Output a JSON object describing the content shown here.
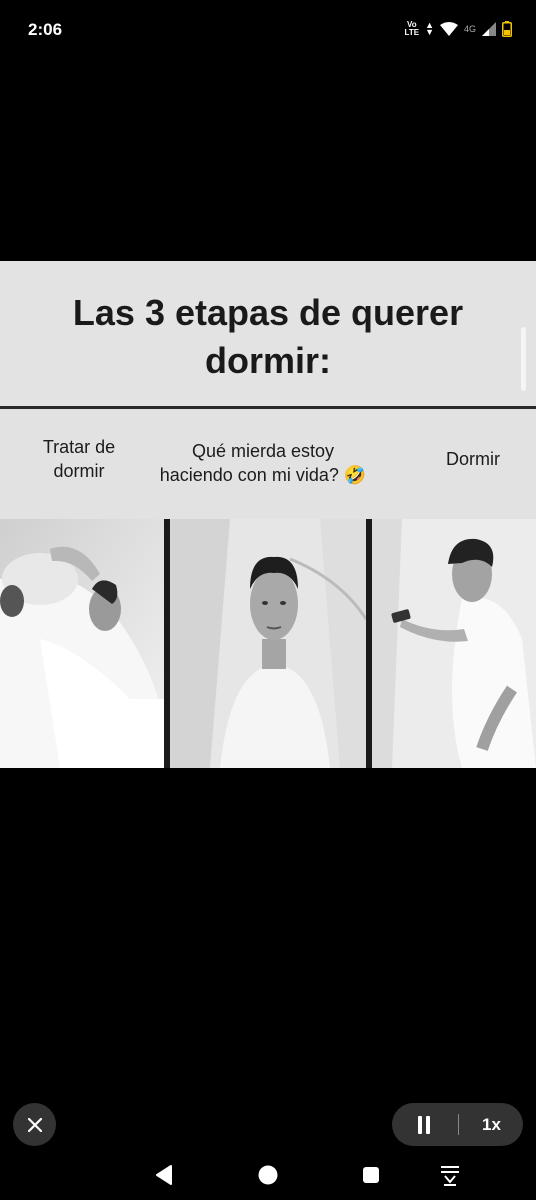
{
  "status_bar": {
    "time": "2:06",
    "volte_line1": "Vo",
    "volte_line2": "LTE",
    "network": "4G",
    "icons": [
      "volte-icon",
      "data-arrows-icon",
      "wifi-icon",
      "signal-icon",
      "battery-icon"
    ]
  },
  "meme": {
    "title": "Las 3 etapas de querer dormir:",
    "captions": [
      {
        "line1": "Tratar de",
        "line2": "dormir"
      },
      {
        "line1": "Qué mierda estoy",
        "line2": "haciendo con mi vida? 🤣"
      },
      {
        "line1": "Dormir"
      }
    ]
  },
  "media_controls": {
    "close_icon": "close-icon",
    "pause_icon": "pause-icon",
    "speed": "1x"
  },
  "nav_bar": {
    "icons": [
      "back-icon",
      "home-icon",
      "recents-icon",
      "keyboard-hide-icon"
    ]
  },
  "colors": {
    "background": "#000000",
    "meme_background": "#e3e3e3",
    "control_background": "#333333"
  }
}
